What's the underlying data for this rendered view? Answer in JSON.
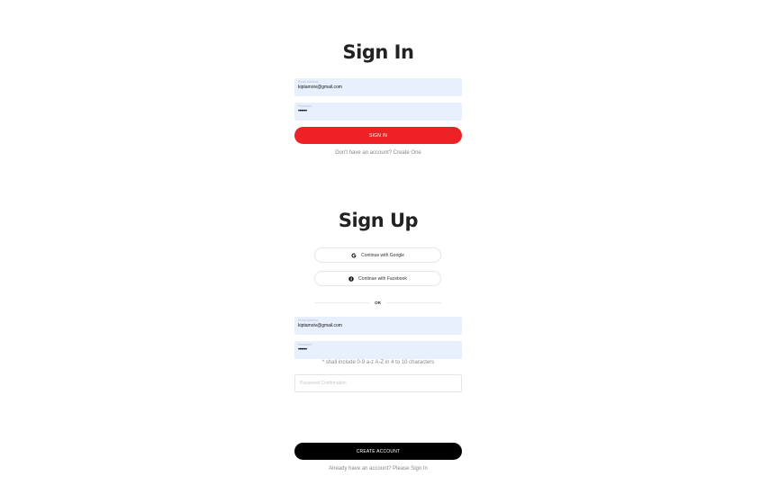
{
  "signin": {
    "title": "Sign In",
    "email_label": "Email Address",
    "email_value": "kiptamoiv@gmail.com",
    "password_label": "Password",
    "password_value": "••••••",
    "submit_label": "SIGN IN",
    "switch_text": "Don't have an account? Create One"
  },
  "signup": {
    "title": "Sign Up",
    "google_label": "Continue with Google",
    "facebook_label": "Continue with Facebook",
    "divider_label": "OR",
    "email_label": "Email Address",
    "email_value": "kiptamoiv@gmail.com",
    "password_label": "Password",
    "password_value": "••••••",
    "password_hint": "* shall include 0-9 a-z A-Z in 4 to 10 characters",
    "confirm_placeholder": "Password Confirmation",
    "submit_label": "CREATE ACCOUNT",
    "switch_text": "Already have an account? Please Sign In"
  },
  "icons": {
    "google": "google-icon",
    "facebook": "facebook-icon"
  },
  "colors": {
    "primary_red": "#ee2127",
    "input_fill": "#e8f0fe",
    "black_button": "#000000"
  }
}
